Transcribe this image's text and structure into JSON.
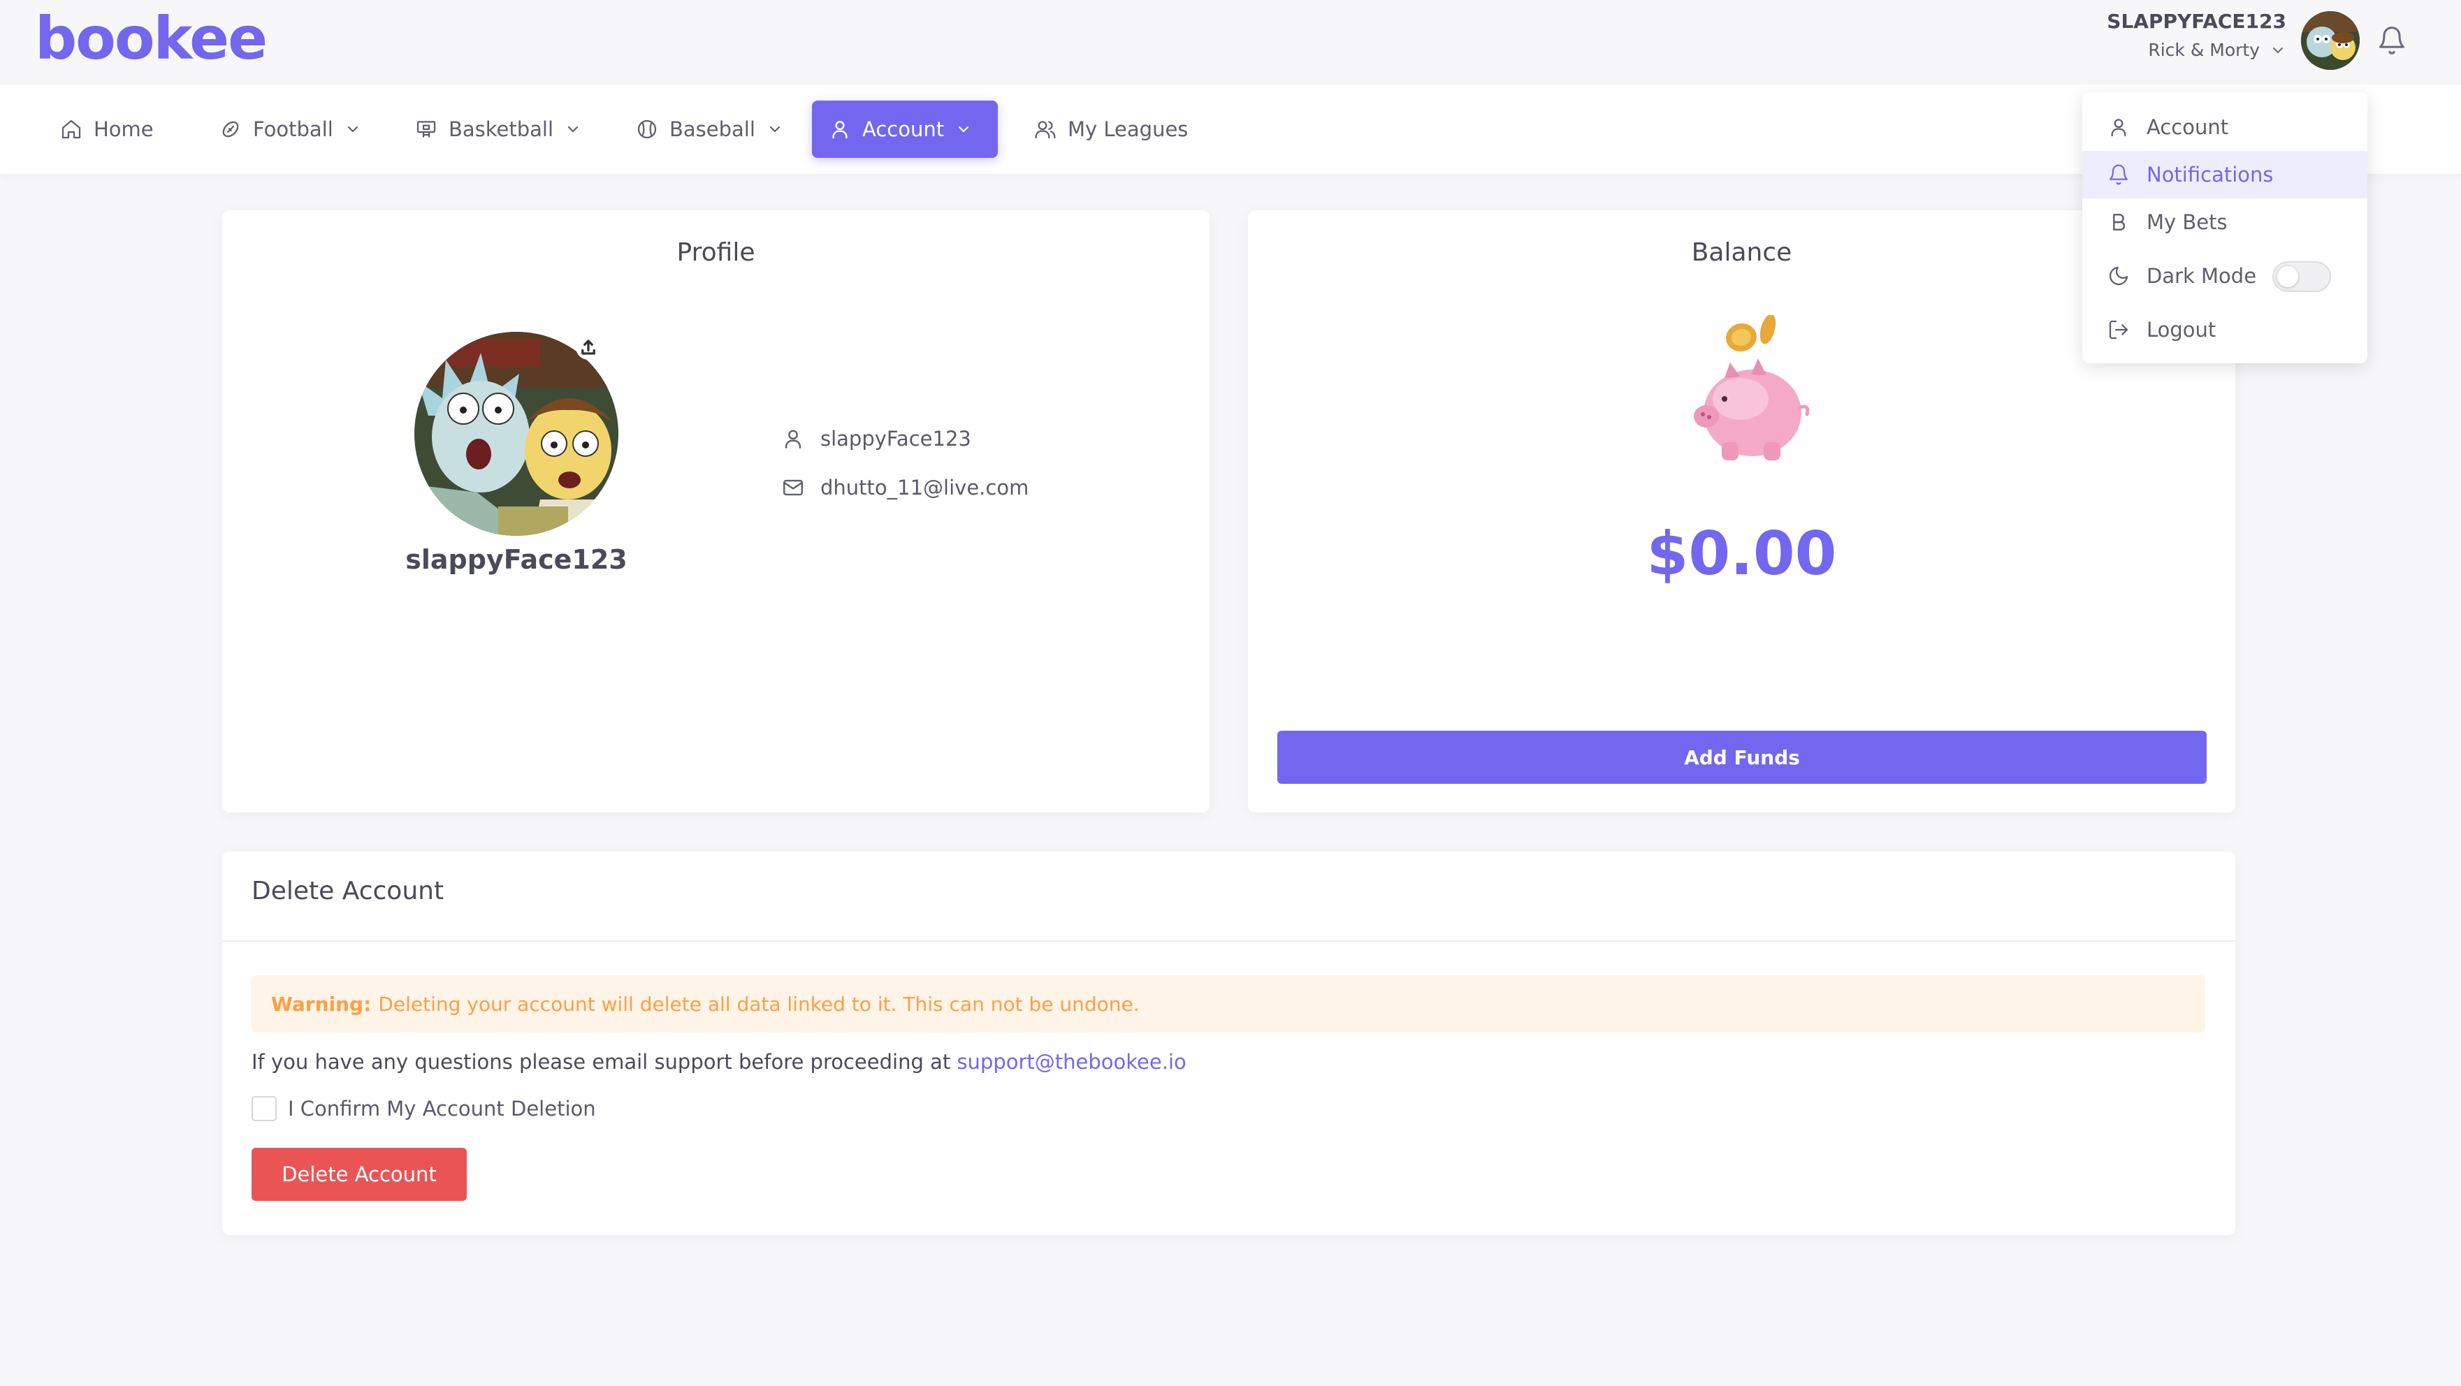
{
  "header": {
    "logo": "bookee",
    "user_name": "SLAPPYFACE123",
    "team_name": "Rick & Morty"
  },
  "nav": {
    "items": [
      {
        "label": "Home",
        "icon": "home-icon"
      },
      {
        "label": "Football",
        "icon": "football-icon"
      },
      {
        "label": "Basketball",
        "icon": "basketball-icon"
      },
      {
        "label": "Baseball",
        "icon": "baseball-icon"
      },
      {
        "label": "Account",
        "icon": "user-icon",
        "active": true
      },
      {
        "label": "My Leagues",
        "icon": "users-icon"
      }
    ]
  },
  "profile": {
    "title": "Profile",
    "display_name": "slappyFace123",
    "username": "slappyFace123",
    "email": "dhutto_11@live.com"
  },
  "balance": {
    "title": "Balance",
    "amount": "$0.00",
    "add_funds_label": "Add Funds"
  },
  "delete_account": {
    "title": "Delete Account",
    "warning_label": "Warning:",
    "warning_text": "Deleting your account will delete all data linked to it. This can not be undone.",
    "question_text": "If you have any questions please email support before proceeding at",
    "support_email": "support@thebookee.io",
    "confirm_label": "I Confirm My Account Deletion",
    "confirm_checked": false,
    "delete_button_label": "Delete Account"
  },
  "user_menu": {
    "items": [
      {
        "label": "Account",
        "icon": "user-icon"
      },
      {
        "label": "Notifications",
        "icon": "bell-icon",
        "active": true
      },
      {
        "label": "My Bets",
        "icon": "bold-b-icon"
      },
      {
        "label": "Dark Mode",
        "icon": "moon-icon",
        "toggle": false
      },
      {
        "label": "Logout",
        "icon": "logout-icon"
      }
    ]
  },
  "colors": {
    "accent": "#7367f0",
    "danger": "#ea5455",
    "warning": "#ff9f43",
    "warning_bg": "#fff4e8"
  }
}
